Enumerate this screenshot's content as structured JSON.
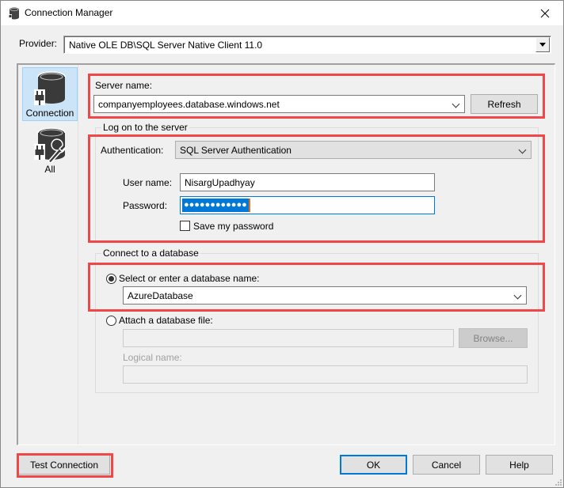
{
  "window": {
    "title": "Connection Manager",
    "icon": "database-icon",
    "close_icon": "close-icon"
  },
  "provider": {
    "label": "Provider:",
    "value": "Native OLE DB\\SQL Server Native Client 11.0"
  },
  "nav": {
    "items": [
      {
        "label": "Connection",
        "icon": "database-plug-icon",
        "selected": true
      },
      {
        "label": "All",
        "icon": "database-plug-wrench-icon",
        "selected": false
      }
    ]
  },
  "server": {
    "label": "Server name:",
    "value": "companyemployees.database.windows.net",
    "refresh_label": "Refresh"
  },
  "logon": {
    "group_title": "Log on to the server",
    "auth_label": "Authentication:",
    "auth_value": "SQL Server Authentication",
    "username_label": "User name:",
    "username_value": "NisargUpadhyay",
    "password_label": "Password:",
    "password_mask": "●●●●●●●●●●●●",
    "save_password_label": "Save my password",
    "save_password_checked": false
  },
  "database": {
    "group_title": "Connect to a database",
    "select_option_label": "Select or enter a database name:",
    "select_option_checked": true,
    "database_value": "AzureDatabase",
    "attach_option_label": "Attach a database file:",
    "attach_option_checked": false,
    "attach_file_value": "",
    "browse_label": "Browse...",
    "logical_name_label": "Logical name:",
    "logical_name_value": ""
  },
  "footer": {
    "test_connection_label": "Test Connection",
    "ok_label": "OK",
    "cancel_label": "Cancel",
    "help_label": "Help"
  },
  "colors": {
    "highlight_box": "#f04848",
    "selection_blue": "#0078d7",
    "nav_selected_bg": "#cce4f7"
  }
}
